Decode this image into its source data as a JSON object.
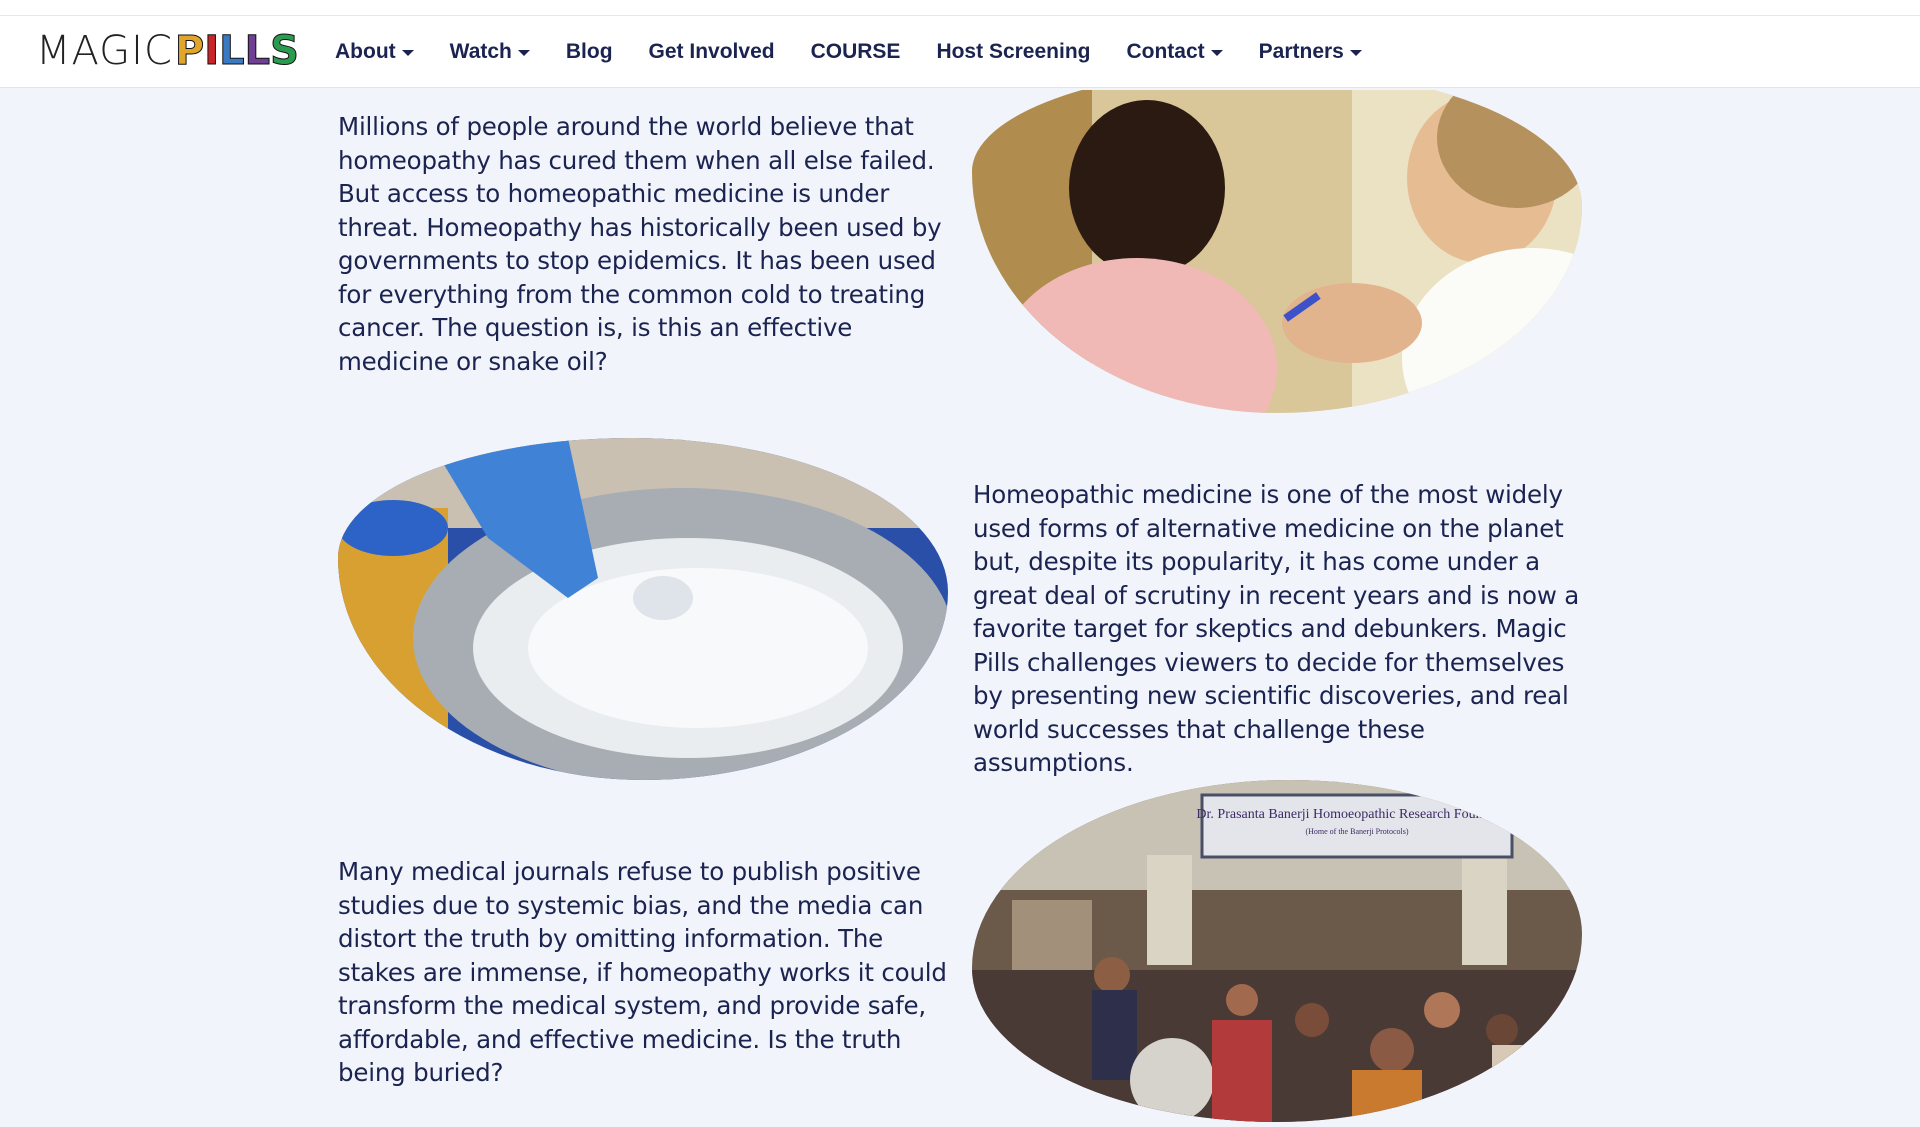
{
  "brand": {
    "logo_text_light": "MAGIC",
    "logo_text_bold": "PILLS",
    "logo_letter_colors": [
      "#e0a52c",
      "#c9242a",
      "#3a7ac3",
      "#6e3f93",
      "#2b9c4f"
    ]
  },
  "nav": {
    "items": [
      {
        "label": "About",
        "dropdown": true
      },
      {
        "label": "Watch",
        "dropdown": true
      },
      {
        "label": "Blog",
        "dropdown": false
      },
      {
        "label": "Get Involved",
        "dropdown": false
      },
      {
        "label": "COURSE",
        "dropdown": false
      },
      {
        "label": "Host Screening",
        "dropdown": false
      },
      {
        "label": "Contact",
        "dropdown": true
      },
      {
        "label": "Partners",
        "dropdown": true
      }
    ]
  },
  "content": {
    "paragraph_1": "Millions of people around the world believe that homeopathy has cured them when all else failed. But access to homeopathic medicine is under threat. Homeopathy has historically been used by governments to stop epidemics. It has been used for everything from the common cold to treating cancer. The question is, is this an effective medicine or snake oil?",
    "paragraph_2": "Homeopathic medicine is one of the most widely used forms of alternative medicine on the planet but, despite its popularity, it has come under a great deal of scrutiny in recent years and is now a favorite target for skeptics and debunkers. Magic Pills challenges viewers to decide for themselves by presenting new scientific discoveries, and real world successes that challenge these assumptions.",
    "paragraph_3": "Many medical journals refuse to publish positive studies due to systemic bias, and the media can distort the truth by omitting information. The stakes are immense, if homeopathy works it could transform the medical system, and provide safe, affordable, and effective medicine. Is the truth being buried?"
  },
  "sign_text": {
    "title": "Dr. Prasanta Banerji Homoeopathic Research Foundation",
    "subtitle": "(Home of the Banerji Protocols)"
  }
}
